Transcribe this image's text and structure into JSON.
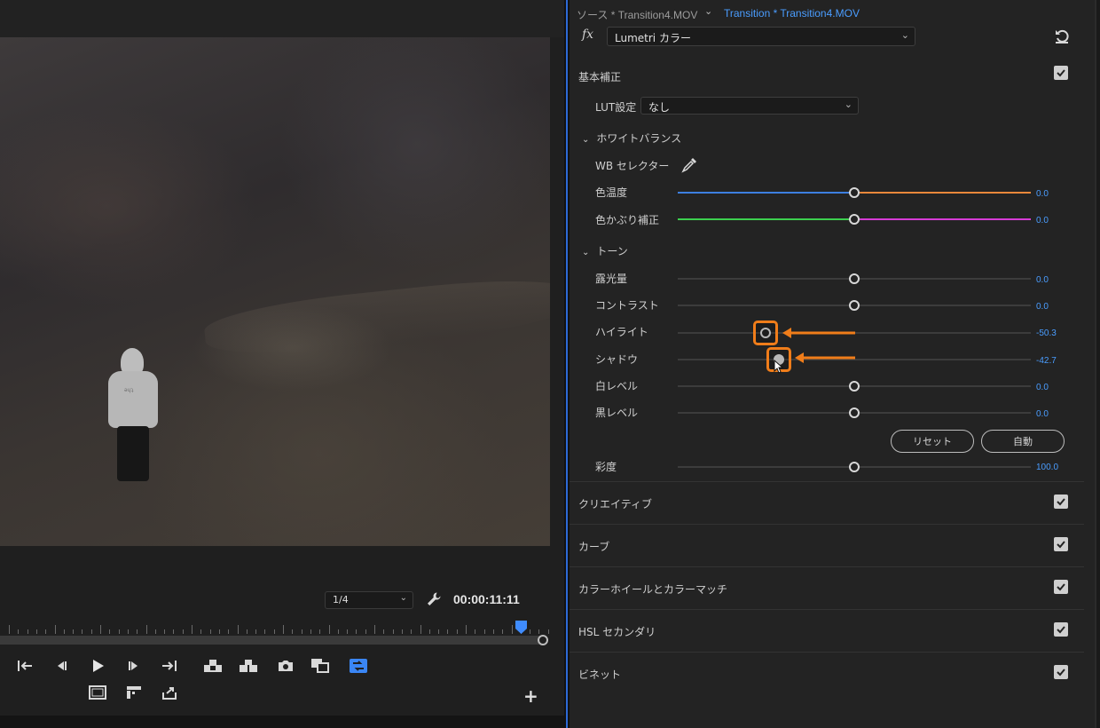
{
  "monitor": {
    "zoom": "1/4",
    "timecode": "00:00:11:11",
    "video_print": "ǝɥʇ"
  },
  "panel": {
    "tab_source": "ソース * Transition4.MOV",
    "tab_sequence": "Transition * Transition4.MOV",
    "fx_label": "fx",
    "effect": "Lumetri カラー",
    "basic": {
      "title": "基本補正",
      "checked": true,
      "lut_label": "LUT設定",
      "lut_value": "なし",
      "white_balance": {
        "title": "ホワイトバランス",
        "wb_selector": "WB セレクター",
        "temperature": {
          "label": "色温度",
          "value": "0.0",
          "level": 0.0
        },
        "tint": {
          "label": "色かぶり補正",
          "value": "0.0",
          "level": 0.0
        }
      },
      "tone": {
        "title": "トーン",
        "exposure": {
          "label": "露光量",
          "value": "0.0",
          "level": 0.0
        },
        "contrast": {
          "label": "コントラスト",
          "value": "0.0",
          "level": 0.0
        },
        "highlights": {
          "label": "ハイライト",
          "value": "-50.3",
          "level": -50.3
        },
        "shadows": {
          "label": "シャドウ",
          "value": "-42.7",
          "level": -42.7
        },
        "whites": {
          "label": "白レベル",
          "value": "0.0",
          "level": 0.0
        },
        "blacks": {
          "label": "黒レベル",
          "value": "0.0",
          "level": 0.0
        },
        "reset_button": "リセット",
        "auto_button": "自動"
      },
      "saturation": {
        "label": "彩度",
        "value": "100.0",
        "level": 100.0
      }
    },
    "sections": [
      {
        "title": "クリエイティブ",
        "checked": true
      },
      {
        "title": "カーブ",
        "checked": true
      },
      {
        "title": "カラーホイールとカラーマッチ",
        "checked": true
      },
      {
        "title": "HSL セカンダリ",
        "checked": true
      },
      {
        "title": "ビネット",
        "checked": true
      }
    ]
  },
  "colors": {
    "accent_blue": "#4a9dff",
    "highlight_orange": "#f07d1a",
    "temp_cool": "#3d7fe0",
    "temp_warm": "#e8883a",
    "tint_green": "#3ccf4e",
    "tint_magenta": "#d63bd6"
  }
}
